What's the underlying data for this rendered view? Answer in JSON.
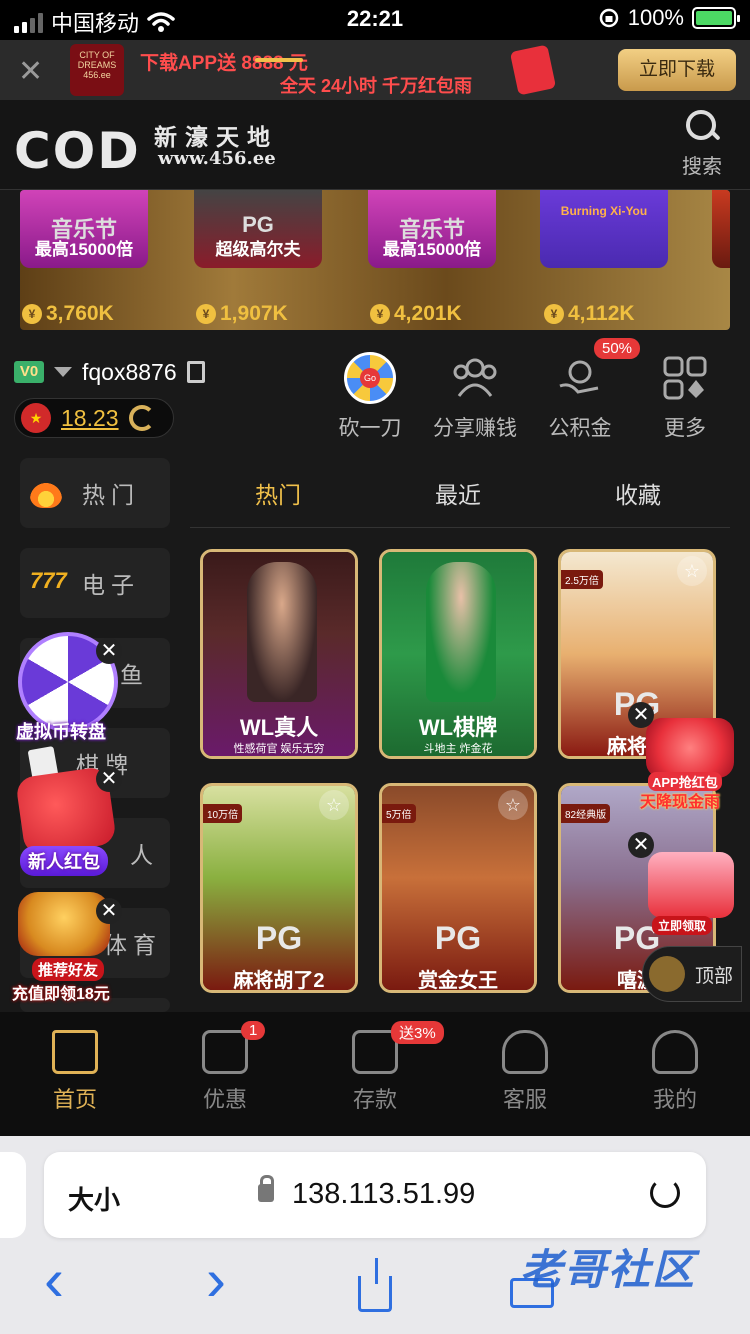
{
  "status_bar": {
    "carrier": "中国移动",
    "time": "22:21",
    "battery_percent": "100%"
  },
  "app_banner": {
    "logo_text": "CITY OF DREAMS 456.ee",
    "line1": "下载APP送 8888 元",
    "line2": "全天 24小时 千万红包雨",
    "button_label": "立即下载"
  },
  "header": {
    "logo_mark": "COD",
    "logo_cn": "新濠天地",
    "logo_url": "www.456.ee",
    "search_label": "搜索"
  },
  "carousel": {
    "cards": [
      {
        "name": "音乐节",
        "sub": "最高15000倍"
      },
      {
        "name": "PG",
        "sub": "超级高尔夫"
      },
      {
        "name": "音乐节",
        "sub": "最高15000倍"
      },
      {
        "name": "Burning Xi-You",
        "sub": ""
      }
    ],
    "jackpots": [
      "3,760K",
      "1,907K",
      "4,201K",
      "4,112K"
    ],
    "coin_symbol": "¥"
  },
  "user": {
    "vip_label": "V0",
    "username": "fqox8876",
    "balance": "18.23"
  },
  "quick_actions": [
    {
      "label": "砍一刀",
      "icon": "lucky-wheel-icon"
    },
    {
      "label": "分享赚钱",
      "icon": "share-people-icon"
    },
    {
      "label": "公积金",
      "icon": "fund-icon",
      "badge": "50%"
    },
    {
      "label": "更多",
      "icon": "more-grid-icon"
    }
  ],
  "categories": [
    {
      "label": "热门",
      "icon": "fire-icon"
    },
    {
      "label": "电子",
      "icon": "slot-777-icon",
      "icon_text": "777"
    },
    {
      "label": "鱼",
      "icon": "fish-icon"
    },
    {
      "label": "棋牌",
      "icon": "cards-icon"
    },
    {
      "label": "人",
      "icon": "live-icon"
    },
    {
      "label": "体育",
      "icon": "sports-icon"
    }
  ],
  "tabs": {
    "hot": "热门",
    "recent": "最近",
    "favorites": "收藏"
  },
  "games": [
    {
      "name": "WL真人",
      "sub": "性感荷官 娱乐无穷",
      "brand": "WL",
      "tag": ""
    },
    {
      "name": "WL棋牌",
      "sub": "斗地主 炸金花",
      "brand": "WL",
      "tag": ""
    },
    {
      "name": "麻将胡",
      "sub": "",
      "brand": "PG",
      "tag": "2.5万倍"
    },
    {
      "name": "麻将胡了2",
      "sub": "",
      "brand": "PG",
      "tag": "10万倍"
    },
    {
      "name": "赏金女王",
      "sub": "",
      "brand": "PG",
      "tag": "5万倍"
    },
    {
      "name": "嘻游",
      "sub": "",
      "brand": "PG",
      "tag": "82经典版"
    }
  ],
  "floats": {
    "wheel_label": "虚拟币转盘",
    "redpacket_label": "新人红包",
    "refer_line1": "推荐好友",
    "refer_line2": "充值即领18元",
    "app_redpacket_line1": "APP抢红包",
    "app_redpacket_line2": "天降现金雨",
    "claim_label": "立即领取",
    "close_symbol": "✕"
  },
  "top_button": {
    "label": "顶部"
  },
  "bottom_nav": [
    {
      "label": "首页",
      "icon": "home-icon",
      "active": true
    },
    {
      "label": "优惠",
      "icon": "gift-icon",
      "badge": "1"
    },
    {
      "label": "存款",
      "icon": "wallet-icon",
      "badge": "送3%"
    },
    {
      "label": "客服",
      "icon": "headset-icon"
    },
    {
      "label": "我的",
      "icon": "user-icon"
    }
  ],
  "safari": {
    "aa_label": "大小",
    "url": "138.113.51.99",
    "back": "‹",
    "forward": "›"
  },
  "watermark": "老哥社区",
  "colors": {
    "accent_gold": "#f0c04a",
    "badge_red": "#e63838",
    "safari_blue": "#2f6fe0"
  }
}
